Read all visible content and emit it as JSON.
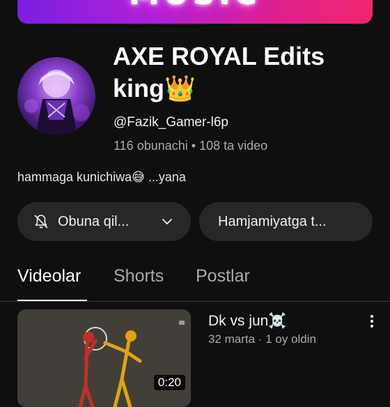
{
  "banner": {
    "text": "MUSIC"
  },
  "channel": {
    "title": "AXE ROYAL Edits king👑",
    "handle": "@Fazik_Gamer-l6p",
    "stats": "116 obunachi • 108 ta video",
    "description": "hammaga kunichiwa😅 ...yana"
  },
  "buttons": {
    "subscribe_label": "Obuna qil...",
    "community_label": "Hamjamiyatga t..."
  },
  "tabs": [
    {
      "label": "Videolar",
      "active": true
    },
    {
      "label": "Shorts",
      "active": false
    },
    {
      "label": "Postlar",
      "active": false
    }
  ],
  "video": {
    "title": "Dk vs jun☠️",
    "meta": "32 marta · 1 oy oldin",
    "duration": "0:20"
  },
  "colors": {
    "background": "#0f0f0f",
    "button_bg": "#272727",
    "secondary_text": "#aaaaaa",
    "banner_start": "#7a1fe0",
    "banner_end": "#f0266d"
  },
  "icons": [
    "bell-off-icon",
    "chevron-down-icon",
    "more-vert-icon"
  ]
}
